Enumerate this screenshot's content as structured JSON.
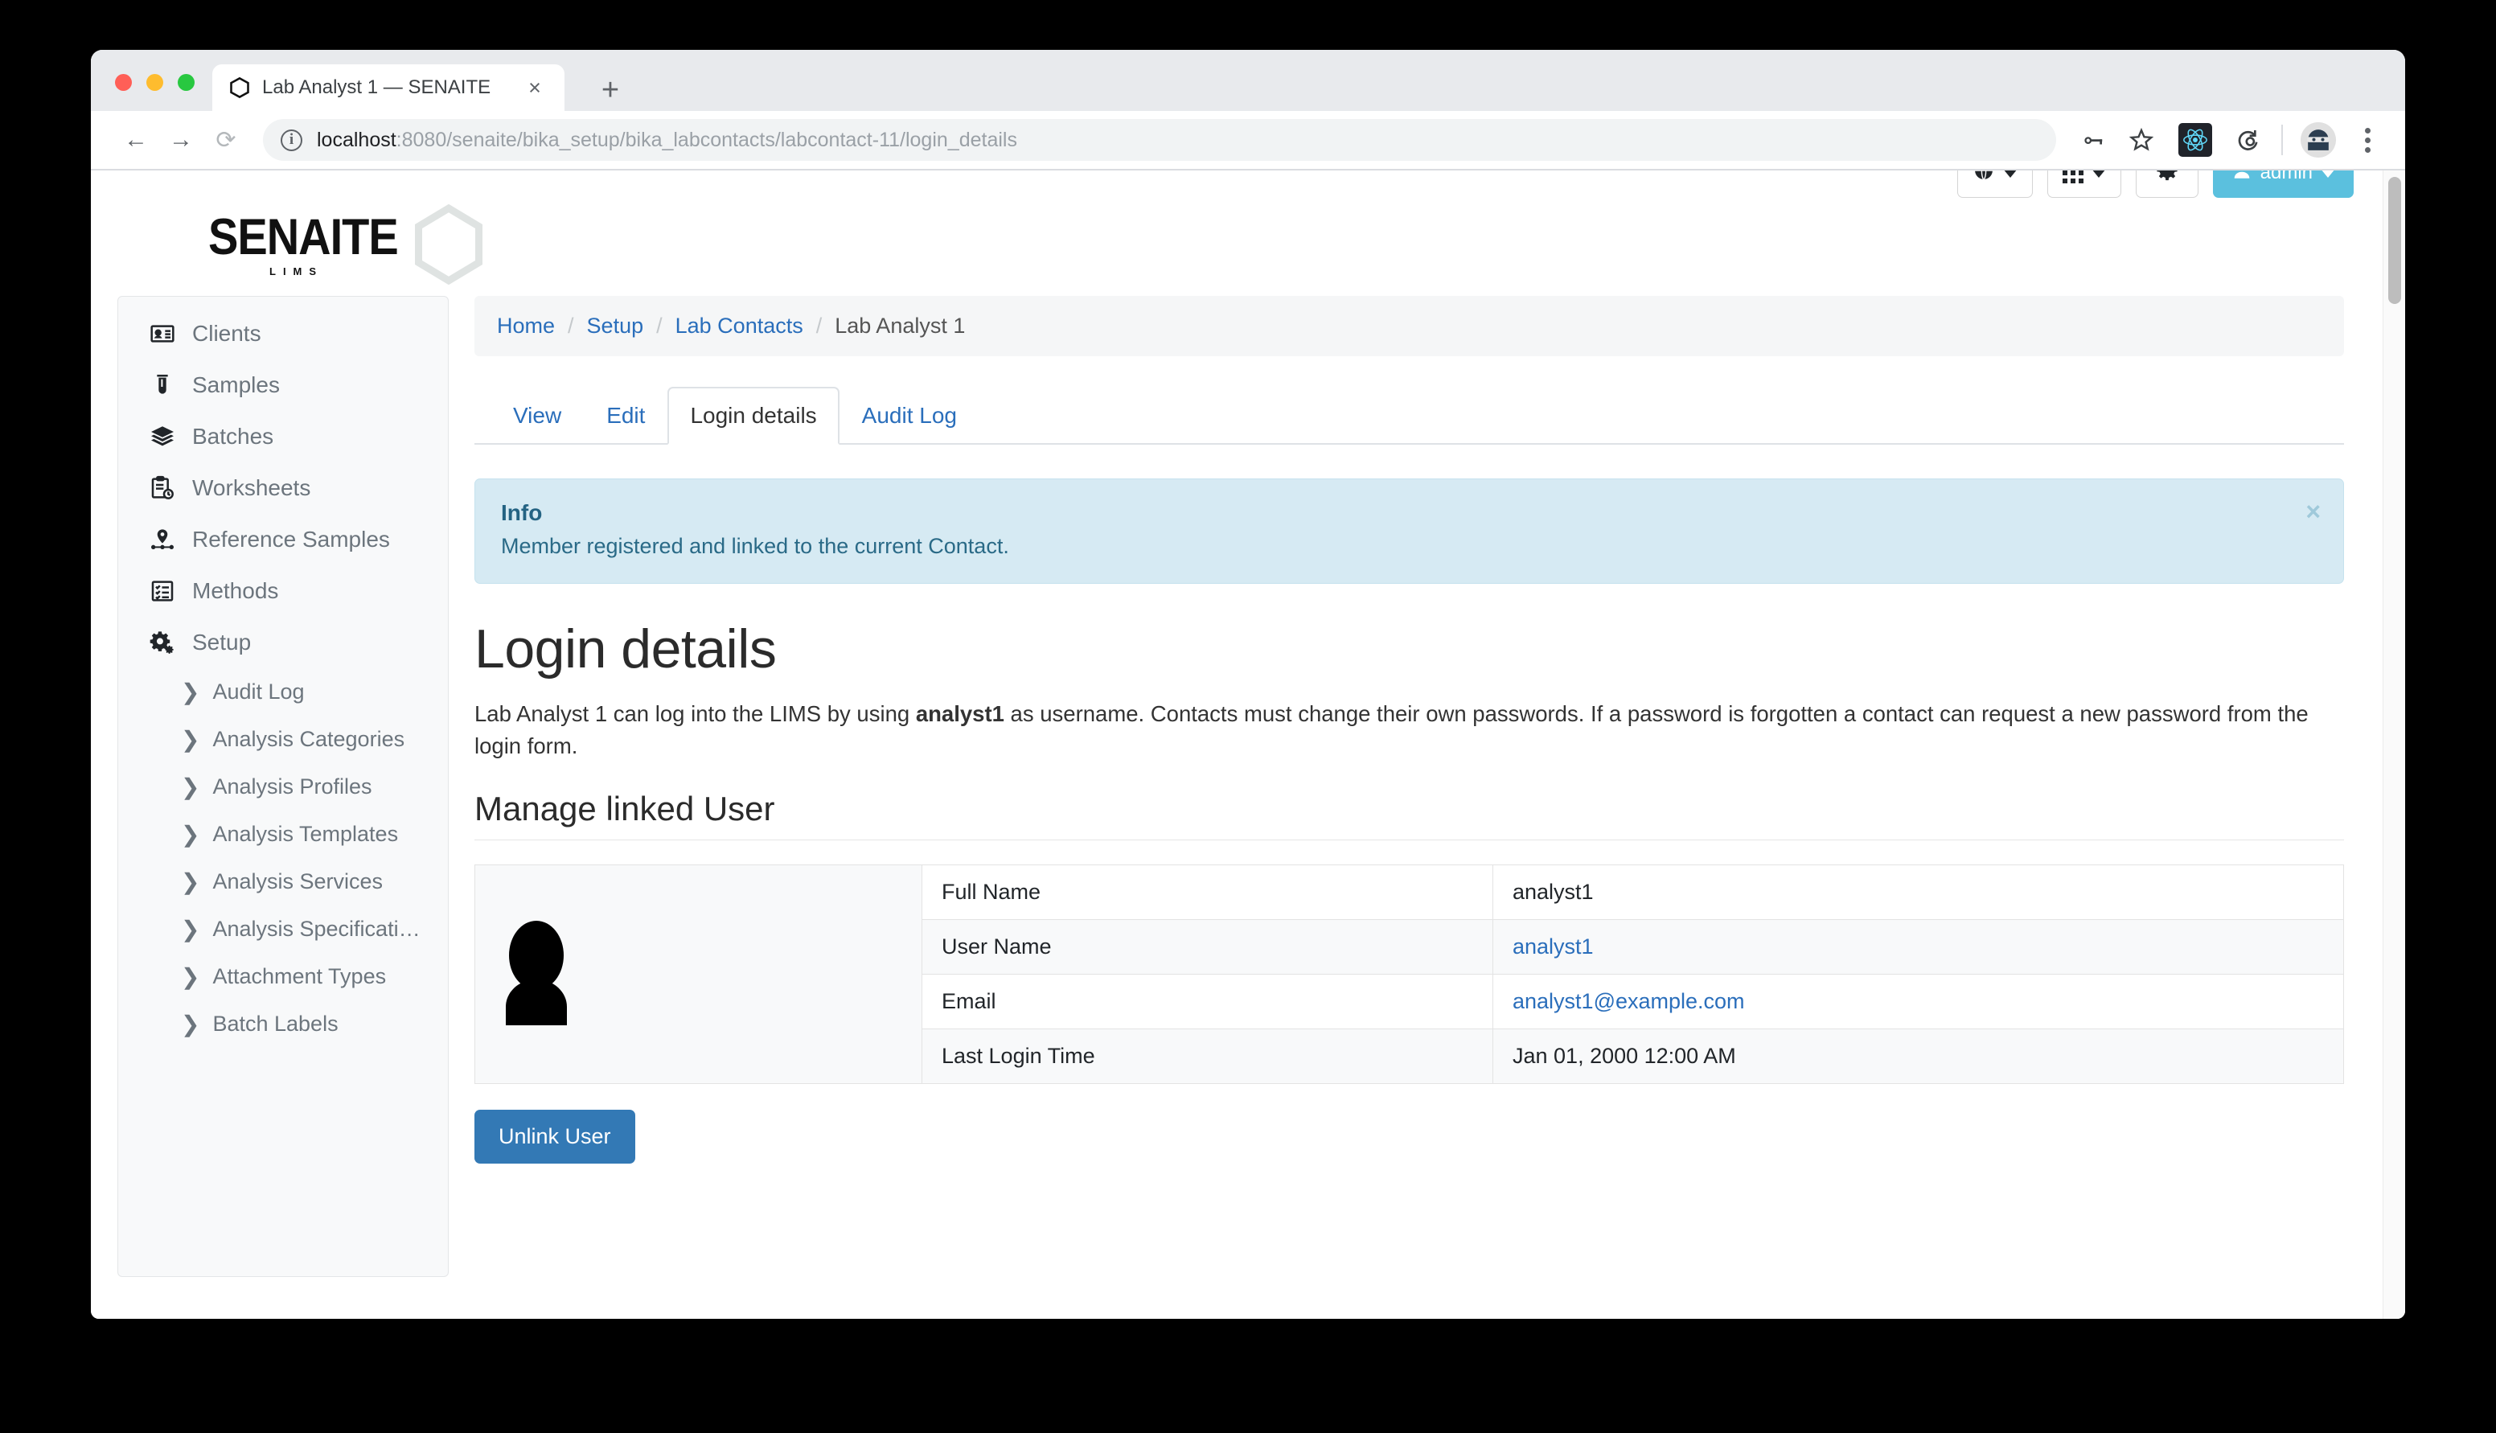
{
  "browser": {
    "tab": {
      "title": "Lab Analyst 1 — SENAITE",
      "favicon": "hexagon-icon",
      "close": "×"
    },
    "new_tab_label": "+",
    "nav": {
      "back": "←",
      "forward": "→",
      "reload": "⟳"
    },
    "omnibox": {
      "security_icon": "info-circle-icon",
      "url_host": "localhost",
      "url_path": ":8080/senaite/bika_setup/bika_labcontacts/labcontact-11/login_details",
      "full_url": "localhost:8080/senaite/bika_setup/bika_labcontacts/labcontact-11/login_details"
    },
    "toolbar_icons": [
      "key-icon",
      "star-icon",
      "react-extension-icon",
      "sync-icon",
      "profile-avatar-icon",
      "kebab-menu-icon"
    ]
  },
  "header": {
    "brand": "SENAITE",
    "brand_sub": "LIMS",
    "actions": [
      {
        "name": "language-dropdown",
        "icon": "globe-icon",
        "label": ""
      },
      {
        "name": "apps-dropdown",
        "icon": "grid-icon",
        "label": ""
      },
      {
        "name": "settings-button",
        "icon": "gear-icon",
        "label": ""
      },
      {
        "name": "user-menu",
        "icon": "user-icon",
        "label": "admin"
      }
    ]
  },
  "sidebar": {
    "items": [
      {
        "label": "Clients",
        "icon": "contact-card-icon"
      },
      {
        "label": "Samples",
        "icon": "test-tube-icon"
      },
      {
        "label": "Batches",
        "icon": "layers-icon"
      },
      {
        "label": "Worksheets",
        "icon": "clipboard-clock-icon"
      },
      {
        "label": "Reference Samples",
        "icon": "map-pin-icon"
      },
      {
        "label": "Methods",
        "icon": "checklist-icon"
      },
      {
        "label": "Setup",
        "icon": "gears-icon"
      }
    ],
    "sub_items": [
      {
        "label": "Audit Log"
      },
      {
        "label": "Analysis Categories"
      },
      {
        "label": "Analysis Profiles"
      },
      {
        "label": "Analysis Templates"
      },
      {
        "label": "Analysis Services"
      },
      {
        "label": "Analysis Specificati…"
      },
      {
        "label": "Attachment Types"
      },
      {
        "label": "Batch Labels"
      }
    ]
  },
  "breadcrumb": {
    "items": [
      "Home",
      "Setup",
      "Lab Contacts"
    ],
    "current": "Lab Analyst 1",
    "separator": "/"
  },
  "content_tabs": [
    {
      "label": "View",
      "active": false
    },
    {
      "label": "Edit",
      "active": false
    },
    {
      "label": "Login details",
      "active": true
    },
    {
      "label": "Audit Log",
      "active": false
    }
  ],
  "alert": {
    "title": "Info",
    "message": "Member registered and linked to the current Contact.",
    "close_label": "×"
  },
  "main": {
    "title": "Login details",
    "description_part1": "Lab Analyst 1 can log into the LIMS by using ",
    "description_bold": "analyst1",
    "description_part2": " as username. Contacts must change their own passwords. If a password is forgotten a contact can request a new password from the login form.",
    "section_title": "Manage linked User",
    "avatar": "user-silhouette-icon",
    "table": {
      "rows": [
        {
          "label": "Full Name",
          "value": "analyst1",
          "is_link": false
        },
        {
          "label": "User Name",
          "value": "analyst1",
          "is_link": true
        },
        {
          "label": "Email",
          "value": "analyst1@example.com",
          "is_link": true
        },
        {
          "label": "Last Login Time",
          "value": "Jan 01, 2000 12:00 AM",
          "is_link": false
        }
      ]
    },
    "unlink_button": "Unlink User"
  },
  "colors": {
    "accent_blue": "#2a6ebb",
    "brand_cyan": "#5bc0de",
    "button_blue": "#3379b5",
    "alert_bg": "#d6eaf3",
    "alert_text": "#2a6a87"
  }
}
